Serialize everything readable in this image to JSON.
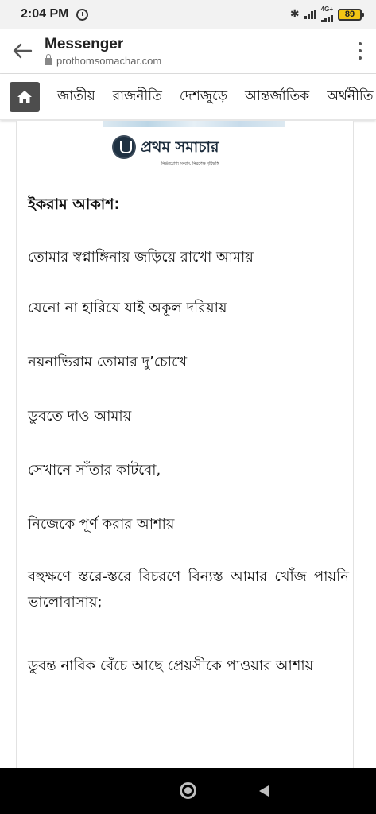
{
  "status_bar": {
    "time": "2:04 PM",
    "network_label": "4G+",
    "battery_level": "89",
    "icons": [
      "alarm-icon",
      "bluetooth-icon",
      "signal-icon",
      "battery-icon"
    ]
  },
  "app_header": {
    "title": "Messenger",
    "url": "prothomsomachar.com",
    "icons": [
      "back-arrow-icon",
      "lock-icon",
      "more-vert-icon"
    ]
  },
  "category_nav": {
    "home_icon": "home-icon",
    "items": [
      {
        "label": "জাতীয়"
      },
      {
        "label": "রাজনীতি"
      },
      {
        "label": "দেশজুড়ে"
      },
      {
        "label": "আন্তর্জাতিক"
      },
      {
        "label": "অর্থনীতি"
      }
    ]
  },
  "article": {
    "logo": {
      "name": "প্রথম সমাচার",
      "tagline": "নির্ভরযোগ্য সংবাদ, নিরপেক্ষ দৃষ্টিভঙ্গি"
    },
    "author": "ইকরাম আকাশ:",
    "lines": [
      "তোমার স্বপ্নাঙ্গিনায় জড়িয়ে রাখো আমায়",
      "যেনো না হারিয়ে যাই অকূল দরিয়ায়",
      "নয়নাভিরাম তোমার দু’চোখে",
      "ডুবতে দাও আমায়",
      "সেখানে সাঁতার কাটবো,",
      "নিজেকে পূর্ণ করার আশায়",
      "বহুক্ষণে স্তরে-স্তরে বিচরণে বিন্যস্ত আমার খোঁজ পায়নি ভালোবাসায়;",
      "ডুবন্ত নাবিক বেঁচে আছে প্রেয়সীকে পাওয়ার আশায়"
    ]
  },
  "nav_bar": {
    "icons": [
      "home-circle-icon",
      "back-triangle-icon"
    ]
  },
  "colors": {
    "home_button_bg": "#4d4d4d",
    "battery": "#f3c614",
    "logo_text": "#1d2d3d"
  }
}
